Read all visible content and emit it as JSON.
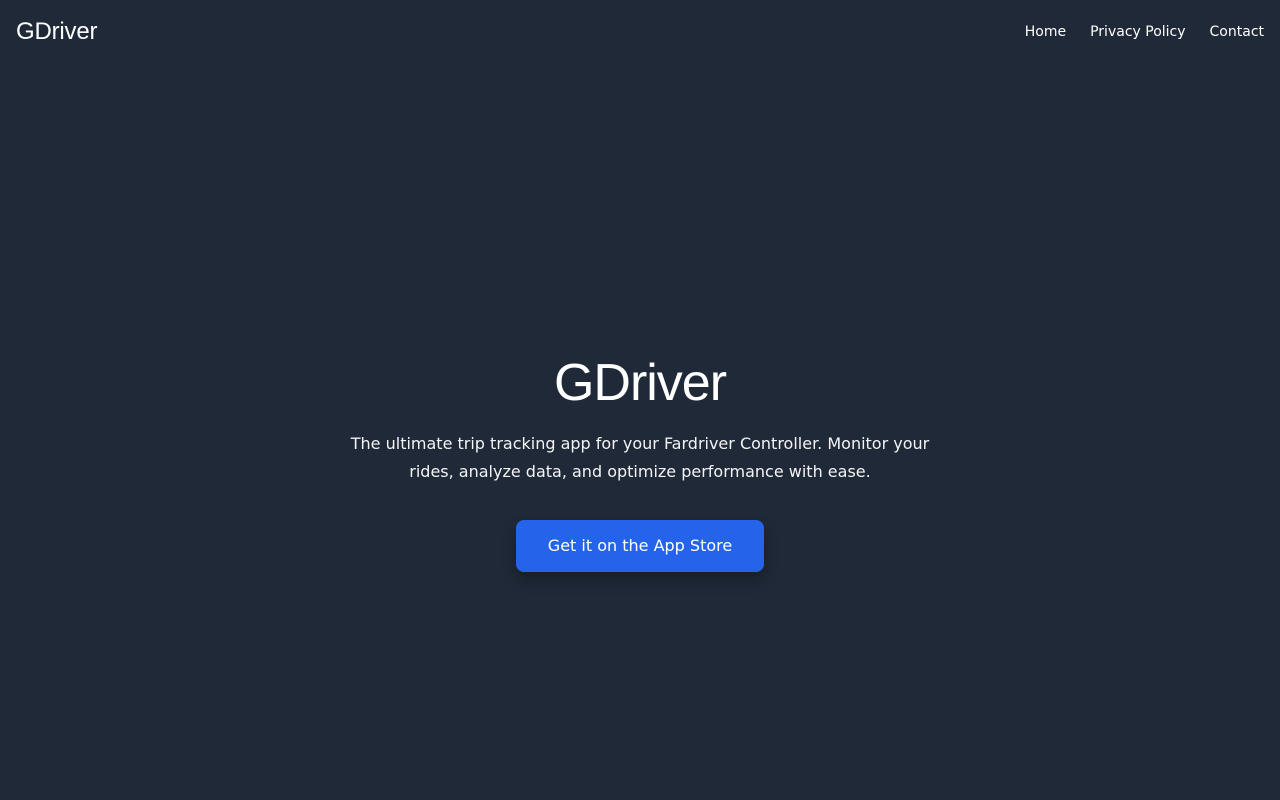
{
  "header": {
    "brand": "GDriver",
    "nav": [
      {
        "label": "Home"
      },
      {
        "label": "Privacy Policy"
      },
      {
        "label": "Contact"
      }
    ]
  },
  "hero": {
    "title": "GDriver",
    "description": "The ultimate trip tracking app for your Fardriver Controller. Monitor your rides, analyze data, and optimize performance with ease.",
    "cta_label": "Get it on the App Store"
  },
  "colors": {
    "background": "#1f2937",
    "accent": "#2563eb",
    "text": "#ffffff"
  }
}
